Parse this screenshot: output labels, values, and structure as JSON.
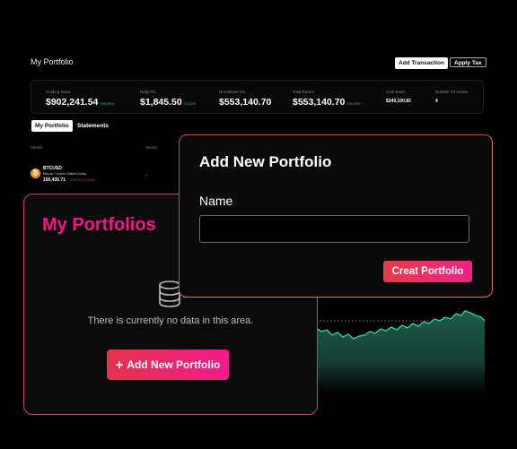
{
  "header": {
    "title": "My Portfolio",
    "add_transaction": "Add Transaction",
    "apply_tax": "Apply Tax"
  },
  "stats": {
    "holding": {
      "label": "Holding Value",
      "value": "$902,241.54",
      "change": "199.45%"
    },
    "daily": {
      "label": "Daily P/L",
      "value": "$1,845.50",
      "change": "0.202%"
    },
    "unrealized": {
      "label": "Unrealized G/L",
      "value": "$553,140.70"
    },
    "total_return": {
      "label": "Total Return",
      "value": "$553,140.70",
      "change": "199.45%"
    },
    "cost_basis": {
      "label": "Cost Basis",
      "value": "$349,100.83"
    },
    "num_assets": {
      "label": "Number Of Assets",
      "value": "4"
    }
  },
  "tabs": {
    "my_portfolio": "My Portfolio",
    "statements": "Statements"
  },
  "table": {
    "col_assets": "Assets",
    "col_sector": "Sector",
    "row": {
      "symbol": "BTCUSD",
      "name": "Bitcoin / United States Dollar",
      "price": "105,435.71",
      "change": "-236.00 (-0.22%)",
      "sector": "-",
      "logo_glyph": "₿"
    }
  },
  "portfolios_panel": {
    "title": "My Portfolios",
    "empty_text": "There is currently no data in this area.",
    "add_button": "Add New Portfolio",
    "plus_glyph": "+"
  },
  "modal": {
    "title": "Add New Portfolio",
    "name_label": "Name",
    "name_value": "",
    "create_button": "Creat Portfolio"
  },
  "colors": {
    "accent_pink": "#f5148c",
    "gain_green": "#19c5a0",
    "loss_red": "#e0434d",
    "chart_fill": "#1d5c4c"
  }
}
